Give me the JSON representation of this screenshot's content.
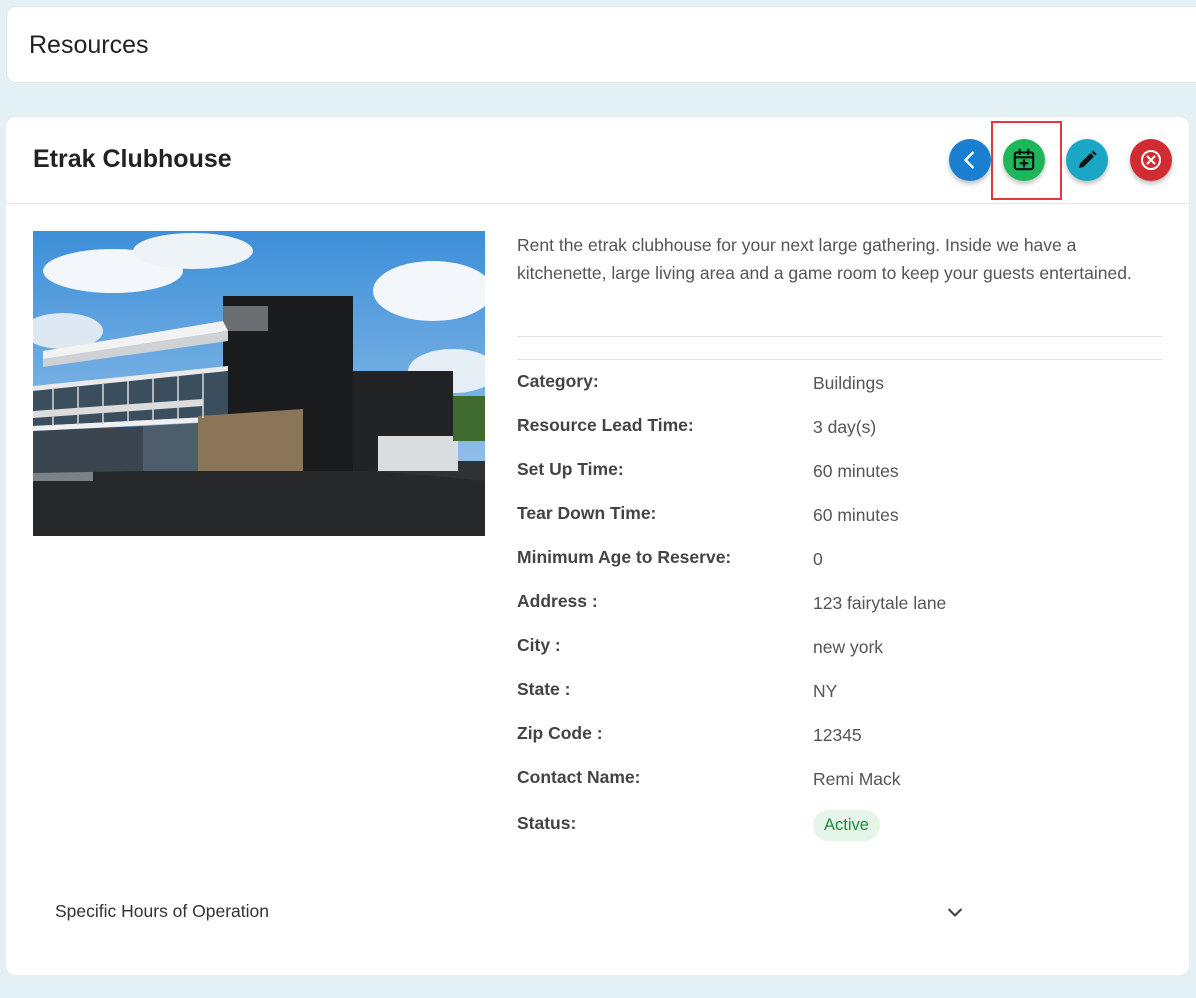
{
  "header": {
    "title": "Resources"
  },
  "resource": {
    "title": "Etrak Clubhouse",
    "description": "Rent the etrak clubhouse for your next large gathering. Inside we have a kitchenette, large living area and a game room to keep your guests entertained.",
    "image_alt": "Etrak Clubhouse building",
    "details": [
      {
        "label": "Category:",
        "value": "Buildings"
      },
      {
        "label": "Resource Lead Time:",
        "value": "3 day(s)"
      },
      {
        "label": "Set Up Time:",
        "value": "60 minutes"
      },
      {
        "label": "Tear Down Time:",
        "value": "60 minutes"
      },
      {
        "label": "Minimum Age to Reserve:",
        "value": "0"
      },
      {
        "label": "Address :",
        "value": "123 fairytale lane"
      },
      {
        "label": "City :",
        "value": "new york"
      },
      {
        "label": "State :",
        "value": "NY"
      },
      {
        "label": "Zip Code :",
        "value": "12345"
      },
      {
        "label": "Contact Name:",
        "value": "Remi Mack"
      }
    ],
    "status": {
      "label": "Status:",
      "value": "Active"
    }
  },
  "actions": {
    "back_icon": "chevron-left-icon",
    "book_icon": "calendar-plus-icon",
    "edit_icon": "pencil-icon",
    "close_icon": "close-circle-icon"
  },
  "accordion": {
    "label": "Specific Hours of Operation"
  },
  "colors": {
    "back": "#1a7fd0",
    "book": "#1fb65a",
    "edit": "#1aa6c4",
    "close": "#d02d32",
    "status_bg": "#e5f5ea",
    "status_text": "#1d8c3d"
  }
}
